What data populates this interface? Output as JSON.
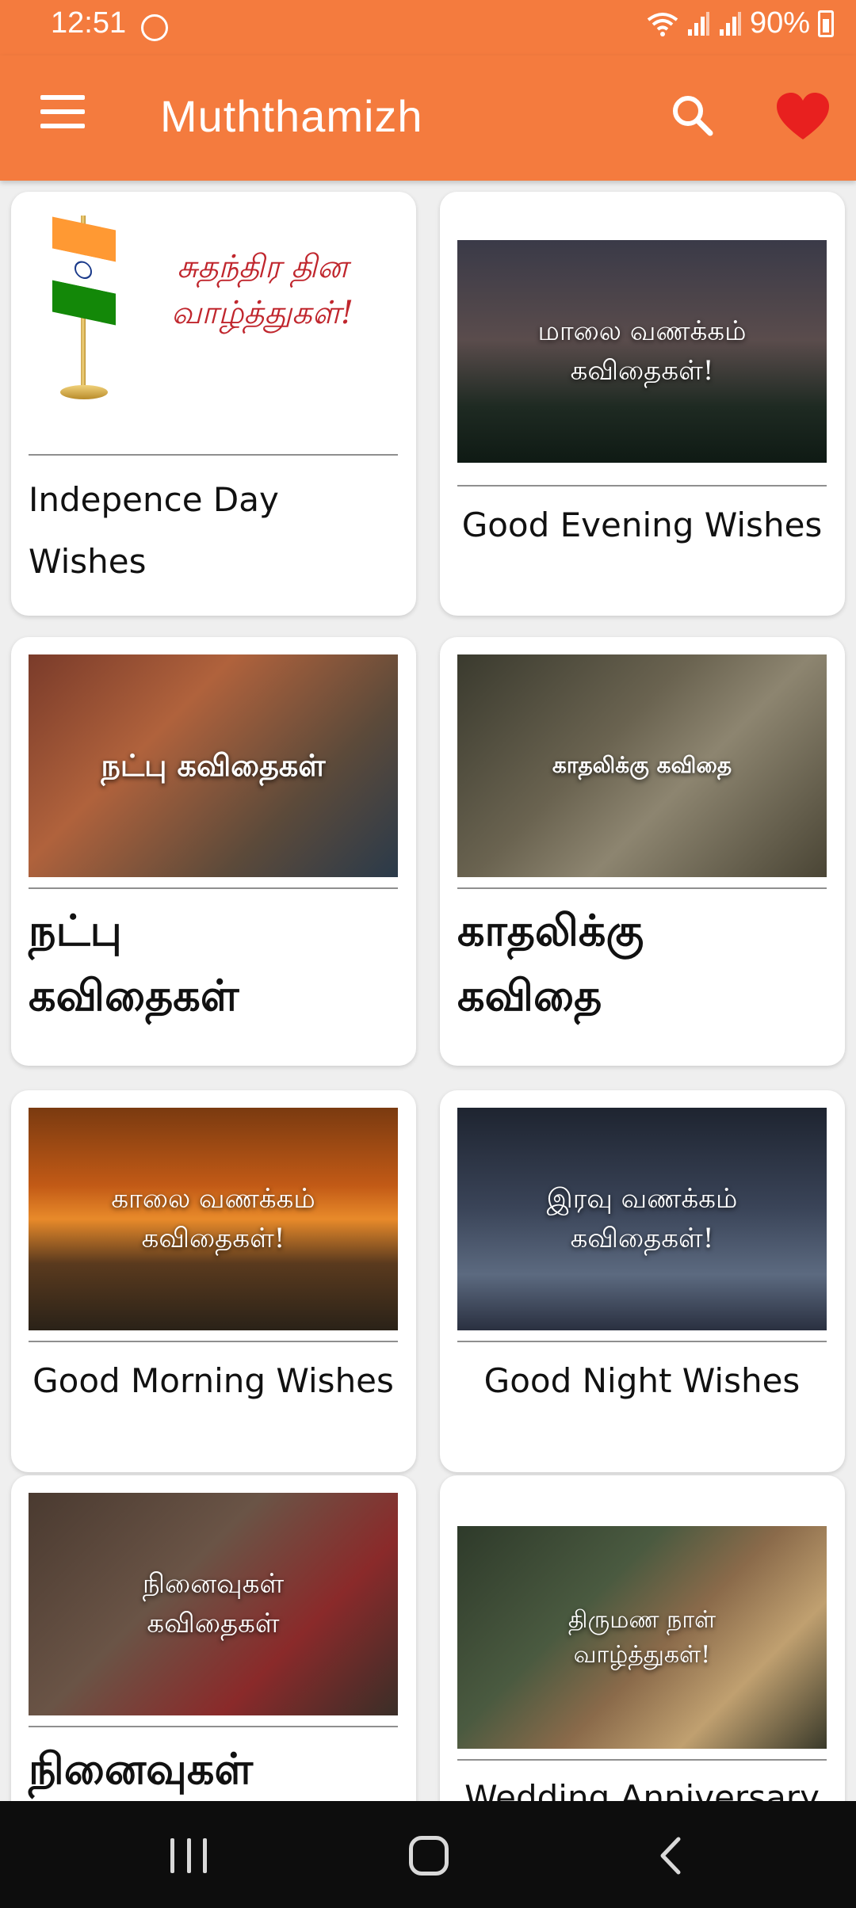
{
  "status_bar": {
    "time": "12:51",
    "battery": "90%"
  },
  "app_bar": {
    "title": "Muththamizh",
    "menu_icon": "hamburger-menu-icon",
    "search_icon": "search-icon",
    "favorite_icon": "heart-icon"
  },
  "colors": {
    "primary": "#f47b3e",
    "favorite": "#e8201f",
    "background": "#efefef"
  },
  "cards": [
    {
      "thumb_text_line1": "சுதந்திர தின",
      "thumb_text_line2": "வாழ்த்துகள்!",
      "label": "Indepence Day Wishes"
    },
    {
      "thumb_text_line1": "மாலை வணக்கம்",
      "thumb_text_line2": "கவிதைகள்!",
      "label": "Good Evening Wishes"
    },
    {
      "thumb_text_line1": "நட்பு கவிதைகள்",
      "label_line1": "நட்பு",
      "label_line2": "கவிதைகள்"
    },
    {
      "thumb_text_line1": "காதலிக்கு கவிதை",
      "label_line1": "காதலிக்கு",
      "label_line2": "கவிதை"
    },
    {
      "thumb_text_line1": "காலை வணக்கம்",
      "thumb_text_line2": "கவிதைகள்!",
      "label": "Good Morning Wishes"
    },
    {
      "thumb_text_line1": "இரவு வணக்கம்",
      "thumb_text_line2": "கவிதைகள்!",
      "label": "Good Night Wishes"
    },
    {
      "thumb_text_line1": "நினைவுகள்",
      "thumb_text_line2": "கவிதைகள்",
      "label": "நினைவுகள்"
    },
    {
      "thumb_text_line1": "திருமண நாள்",
      "thumb_text_line2": "வாழ்த்துகள்!",
      "label": "Wedding Anniversary"
    }
  ],
  "nav_bar": {
    "recent_icon": "recent-apps-icon",
    "home_icon": "home-icon",
    "back_icon": "back-icon"
  }
}
